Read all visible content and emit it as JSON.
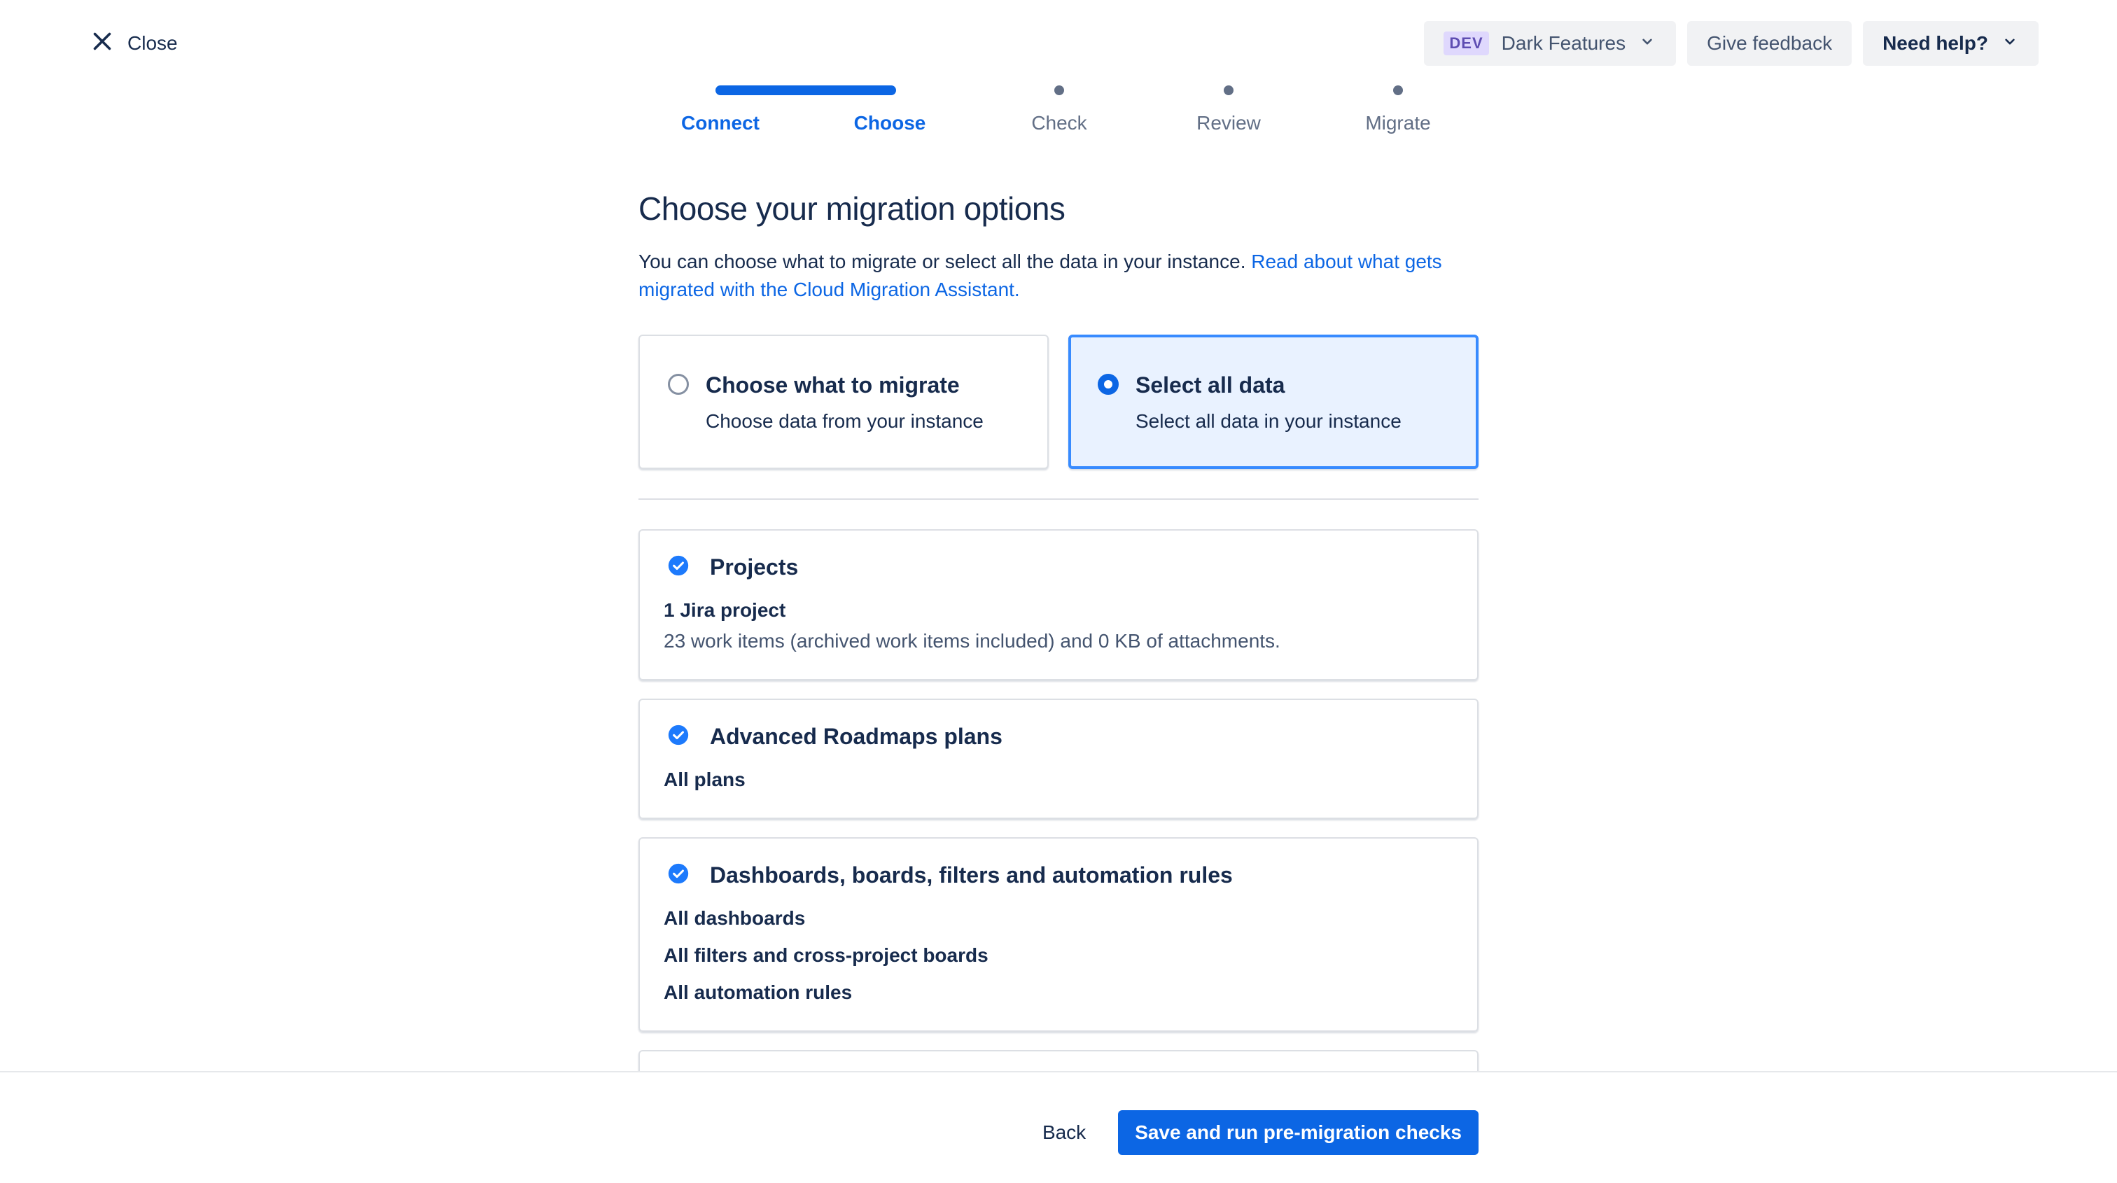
{
  "header": {
    "close_label": "Close",
    "close_icon": "close-icon",
    "env_badge": "DEV",
    "env_label": "Dark Features",
    "feedback_label": "Give feedback",
    "help_label": "Need help?"
  },
  "stepper": {
    "steps": [
      {
        "label": "Connect",
        "state": "done"
      },
      {
        "label": "Choose",
        "state": "current"
      },
      {
        "label": "Check",
        "state": "upcoming"
      },
      {
        "label": "Review",
        "state": "upcoming"
      },
      {
        "label": "Migrate",
        "state": "upcoming"
      }
    ]
  },
  "main": {
    "title": "Choose your migration options",
    "description": "You can choose what to migrate or select all the data in your instance.",
    "description_link": "Read about what gets migrated with the Cloud Migration Assistant.",
    "options": [
      {
        "title": "Choose what to migrate",
        "subtitle": "Choose data from your instance",
        "selected": false
      },
      {
        "title": "Select all data",
        "subtitle": "Select all data in your instance",
        "selected": true
      }
    ],
    "cards": [
      {
        "title": "Projects",
        "lines": [
          "1 Jira project"
        ],
        "sub": "23 work items (archived work items included) and 0 KB of attachments."
      },
      {
        "title": "Advanced Roadmaps plans",
        "lines": [
          "All plans"
        ]
      },
      {
        "title": "Dashboards, boards, filters and automation rules",
        "lines": [
          "All dashboards",
          "All filters and cross-project boards",
          "All automation rules"
        ]
      }
    ]
  },
  "footer": {
    "back_label": "Back",
    "primary_label": "Save and run pre-migration checks"
  },
  "colors": {
    "accent": "#0c66e4",
    "selected_bg": "#e9f2ff",
    "selected_border": "#388bff",
    "text": "#172b4d",
    "subtle_text": "#626f86"
  }
}
